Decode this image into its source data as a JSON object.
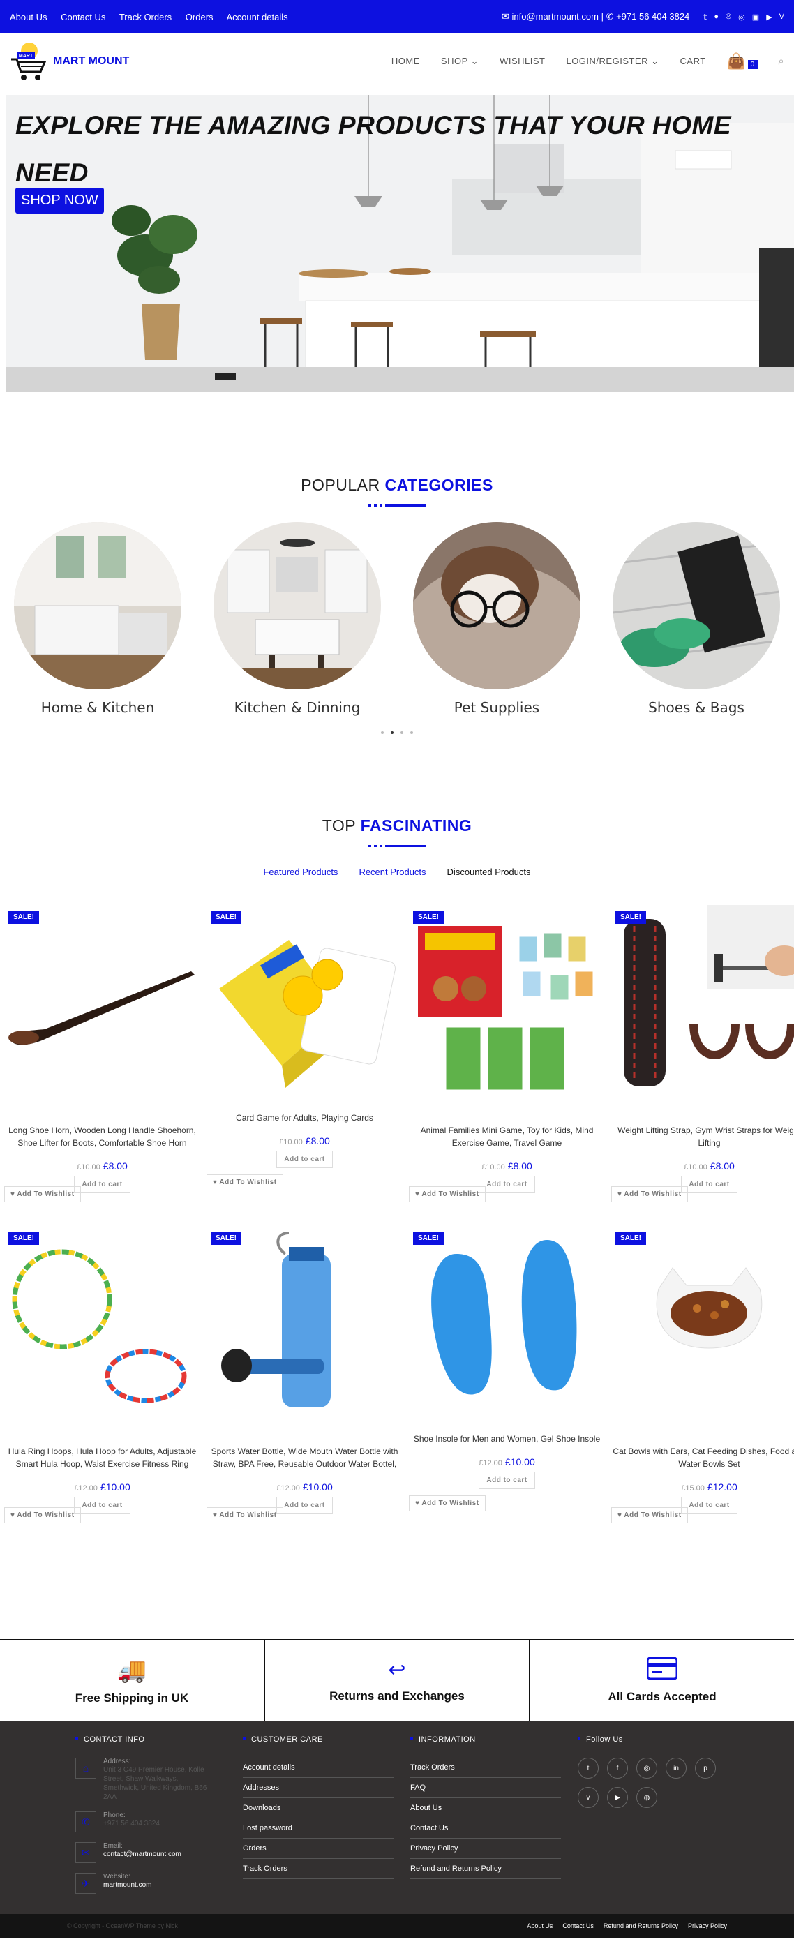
{
  "topbar": {
    "links": [
      "About Us",
      "Contact Us",
      "Track Orders",
      "Orders",
      "Account details"
    ],
    "email": "info@martmount.com",
    "phone": "+971 56 404 3824",
    "social_icons": [
      "twitter-icon",
      "facebook-icon",
      "pinterest-icon",
      "instagram-icon",
      "linkedin-icon",
      "youtube-icon",
      "vimeo-icon"
    ]
  },
  "header": {
    "logo_text": "MART MOUNT",
    "logo_badge": "MART",
    "nav": [
      "HOME",
      "SHOP",
      "WISHLIST",
      "LOGIN/REGISTER",
      "CART"
    ],
    "cart_count": "0"
  },
  "hero": {
    "headline": "EXPLORE THE AMAZING PRODUCTS THAT YOUR HOME NEED",
    "cta": "SHOP NOW"
  },
  "categories": {
    "title_plain": "POPULAR",
    "title_accent": "CATEGORIES",
    "items": [
      "Home & Kitchen",
      "Kitchen & Dinning",
      "Pet Supplies",
      "Shoes & Bags"
    ]
  },
  "products_section": {
    "title_plain": "TOP",
    "title_accent": "FASCINATING",
    "tabs": [
      "Featured Products",
      "Recent Products",
      "Discounted Products"
    ],
    "sale_label": "SALE!",
    "add_to_cart": "Add to cart",
    "add_to_wishlist": "Add To Wishlist",
    "items": [
      {
        "title": "Long Shoe Horn, Wooden Long Handle Shoehorn, Shoe Lifter for Boots, Comfortable Shoe Horn",
        "old_price": "£10.00",
        "price": "£8.00"
      },
      {
        "title": "Card Game for Adults, Playing Cards",
        "old_price": "£10.00",
        "price": "£8.00"
      },
      {
        "title": "Animal Families Mini Game, Toy for Kids, Mind Exercise Game, Travel Game",
        "old_price": "£10.00",
        "price": "£8.00"
      },
      {
        "title": "Weight Lifting Strap, Gym Wrist Straps for Weight Lifting",
        "old_price": "£10.00",
        "price": "£8.00"
      },
      {
        "title": "Hula Ring Hoops, Hula Hoop for Adults, Adjustable Smart Hula Hoop, Waist Exercise Fitness Ring",
        "old_price": "£12.00",
        "price": "£10.00"
      },
      {
        "title": "Sports Water Bottle, Wide Mouth Water Bottle with Straw, BPA Free, Reusable Outdoor Water Bottel,",
        "old_price": "£12.00",
        "price": "£10.00"
      },
      {
        "title": "Shoe Insole for Men and Women, Gel Shoe Insole",
        "old_price": "£12.00",
        "price": "£10.00"
      },
      {
        "title": "Cat Bowls with Ears, Cat Feeding Dishes, Food and Water Bowls Set",
        "old_price": "£15.00",
        "price": "£12.00"
      }
    ]
  },
  "features": [
    "Free Shipping in UK",
    "Returns and Exchanges",
    "All Cards Accepted"
  ],
  "footer": {
    "contact_title": "CONTACT INFO",
    "address_label": "Address:",
    "address": "Unit 3 C49 Premier House, Kolle Street, Shaw Walkways, Smethwick, United Kingdom, B66 2AA",
    "phone_label": "Phone:",
    "phone": "+971 56 404 3824",
    "email_label": "Email:",
    "email": "contact@martmount.com",
    "website_label": "Website:",
    "website": "martmount.com",
    "care_title": "CUSTOMER CARE",
    "care_links": [
      "Account details",
      "Addresses",
      "Downloads",
      "Lost password",
      "Orders",
      "Track Orders"
    ],
    "info_title": "INFORMATION",
    "info_links": [
      "Track Orders",
      "FAQ",
      "About Us",
      "Contact Us",
      "Privacy Policy",
      "Refund and Returns Policy"
    ],
    "follow_title": "Follow Us",
    "follow_icons": [
      "twitter-icon",
      "facebook-icon",
      "instagram-icon",
      "linkedin-icon",
      "pinterest-icon",
      "vimeo-icon",
      "youtube-icon",
      "dribbble-icon"
    ]
  },
  "bottombar": {
    "copyright": "© Copyright - OceanWP Theme by Nick",
    "links": [
      "About Us",
      "Contact Us",
      "Refund and Returns Policy",
      "Privacy Policy"
    ]
  }
}
